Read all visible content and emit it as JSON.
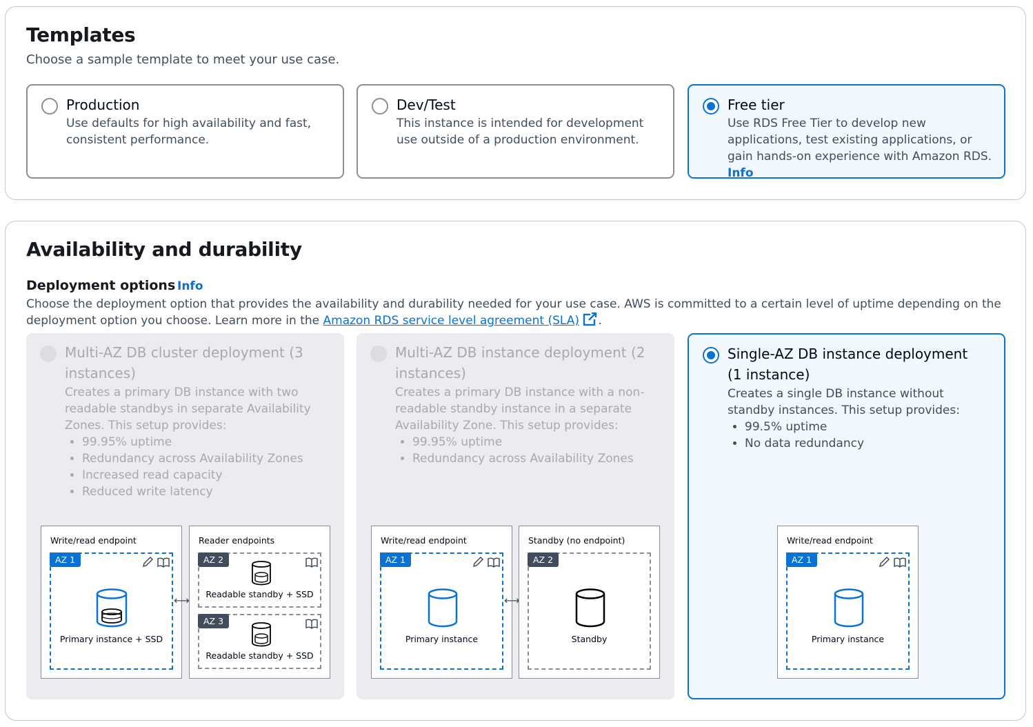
{
  "templates": {
    "heading": "Templates",
    "description": "Choose a sample template to meet your use case.",
    "options": [
      {
        "title": "Production",
        "description": "Use defaults for high availability and fast, consistent performance.",
        "selected": false
      },
      {
        "title": "Dev/Test",
        "description": "This instance is intended for development use outside of a production environment.",
        "selected": false
      },
      {
        "title": "Free tier",
        "description": "Use RDS Free Tier to develop new applications, test existing applications, or gain hands-on experience with Amazon RDS.",
        "info": "Info",
        "selected": true
      }
    ]
  },
  "availability": {
    "heading": "Availability and durability",
    "deployment_label": "Deployment options",
    "deployment_info": "Info",
    "description_pre": "Choose the deployment option that provides the availability and durability needed for your use case. AWS is committed to a certain level of uptime depending on the deployment option you choose. Learn more in the ",
    "sla_link": "Amazon RDS service level agreement (SLA)",
    "description_post": ".",
    "external_link_icon": "external-link-icon",
    "options": [
      {
        "title": "Multi-AZ DB cluster deployment (3 instances)",
        "description": "Creates a primary DB instance with two readable standbys in separate Availability Zones. This setup provides:",
        "bullets": [
          "99.95% uptime",
          "Redundancy across Availability Zones",
          "Increased read capacity",
          "Reduced write latency"
        ],
        "disabled": true,
        "diagram": {
          "writer_label": "Write/read endpoint",
          "reader_label": "Reader endpoints",
          "az1": "AZ 1",
          "az2": "AZ 2",
          "az3": "AZ 3",
          "primary_caption": "Primary instance + SSD",
          "standby1_caption": "Readable standby + SSD",
          "standby2_caption": "Readable standby + SSD"
        }
      },
      {
        "title": "Multi-AZ DB instance deployment (2 instances)",
        "description": "Creates a primary DB instance with a non-readable standby instance in a separate Availability Zone. This setup provides:",
        "bullets": [
          "99.95% uptime",
          "Redundancy across Availability Zones"
        ],
        "disabled": true,
        "diagram": {
          "writer_label": "Write/read endpoint",
          "standby_label": "Standby (no endpoint)",
          "az1": "AZ 1",
          "az2": "AZ 2",
          "primary_caption": "Primary instance",
          "standby_caption": "Standby"
        }
      },
      {
        "title": "Single-AZ DB instance deployment (1 instance)",
        "description": "Creates a single DB instance without standby instances. This setup provides:",
        "bullets": [
          "99.5% uptime",
          "No data redundancy"
        ],
        "selected": true,
        "diagram": {
          "writer_label": "Write/read endpoint",
          "az1": "AZ 1",
          "primary_caption": "Primary instance"
        }
      }
    ]
  },
  "colors": {
    "accent": "#0972d3",
    "disabled_bg": "#ebebf0",
    "selected_bg": "#f2f8fd"
  }
}
